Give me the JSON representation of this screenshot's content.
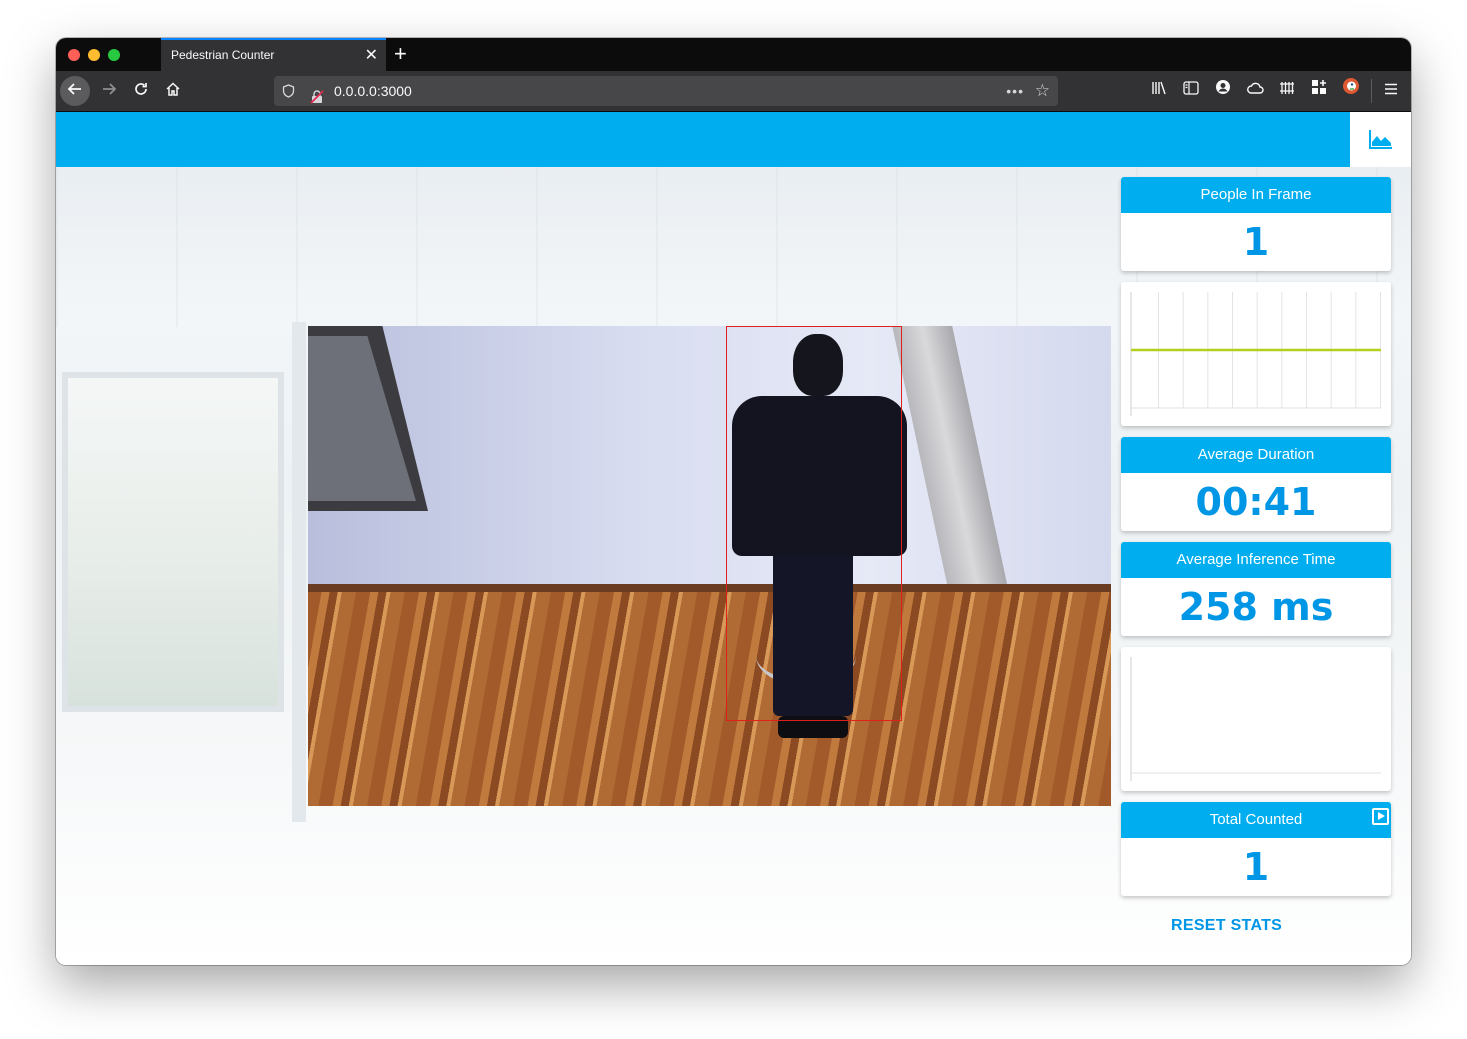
{
  "browser": {
    "tab_title": "Pedestrian Counter",
    "tab_close": "✕",
    "new_tab": "+",
    "url": "0.0.0.0:3000",
    "url_more": "•••"
  },
  "stats": {
    "people_in_frame": {
      "label": "People In Frame",
      "value": "1"
    },
    "average_duration": {
      "label": "Average Duration",
      "value": "00:41"
    },
    "average_inference": {
      "label": "Average Inference Time",
      "value": "258 ms"
    },
    "total_counted": {
      "label": "Total Counted",
      "value": "1"
    }
  },
  "reset_label": "RESET STATS",
  "colors": {
    "accent": "#00aeef",
    "value_text": "#0096e6",
    "line": "#b5cf1e",
    "bbox": "#e0201b"
  },
  "chart_data": [
    {
      "type": "line",
      "series": [
        {
          "values": [
            1,
            1,
            1,
            1,
            1,
            1,
            1,
            1,
            1,
            1
          ]
        }
      ],
      "ylim": [
        0,
        2
      ],
      "grid": true
    },
    {
      "type": "line",
      "series": [
        {
          "values": []
        }
      ],
      "grid": false
    }
  ]
}
